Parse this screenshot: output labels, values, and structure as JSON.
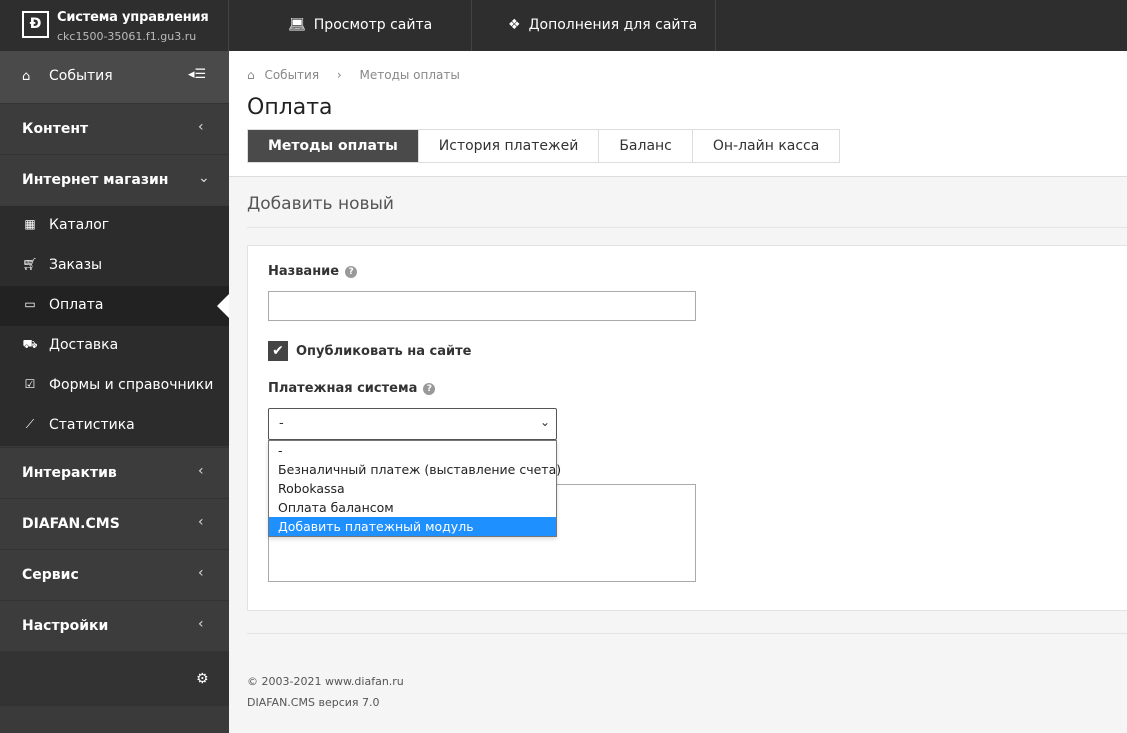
{
  "brand": {
    "logo": "Ɖ",
    "title": "Система управления",
    "subtitle": "ckc1500-35061.f1.gu3.ru"
  },
  "topnav": {
    "view_site": "Просмотр сайта",
    "view_site_icon": "laptop-icon",
    "addons": "Дополнения для сайта",
    "addons_icon": "cubes-icon"
  },
  "sidebar": {
    "events": "События",
    "sections": {
      "content": "Контент",
      "shop": "Интернет магазин",
      "interactive": "Интерактив",
      "diafan": "DIAFAN.CMS",
      "service": "Сервис",
      "settings": "Настройки"
    },
    "shop_items": [
      {
        "label": "Каталог",
        "icon": "grid-icon"
      },
      {
        "label": "Заказы",
        "icon": "cart-icon"
      },
      {
        "label": "Оплата",
        "icon": "credit-card-icon"
      },
      {
        "label": "Доставка",
        "icon": "truck-icon"
      },
      {
        "label": "Формы и справочники",
        "icon": "checkbox-icon"
      },
      {
        "label": "Статистика",
        "icon": "line-chart-icon"
      }
    ]
  },
  "breadcrumb": {
    "home": "События",
    "current": "Методы оплаты"
  },
  "page_title": "Оплата",
  "tabs": [
    "Методы оплаты",
    "История платежей",
    "Баланс",
    "Он-лайн касса"
  ],
  "form": {
    "section_title": "Добавить новый",
    "name_label": "Название",
    "name_value": "",
    "publish_label": "Опубликовать на сайте",
    "publish_checked": true,
    "payment_system_label": "Платежная система",
    "payment_system_value": "-",
    "payment_options": [
      "-",
      "Безналичный платеж (выставление счета)",
      "Robokassa",
      "Оплата балансом",
      "Добавить платежный модуль"
    ],
    "highlighted_option": "Добавить платежный модуль"
  },
  "footer": {
    "copyright": "© 2003-2021 www.diafan.ru",
    "version": "DIAFAN.CMS версия 7.0"
  },
  "colors": {
    "sidebar": "#3a3a3a",
    "topbar": "#2e2e2e",
    "accent": "#1e90ff",
    "active_tab": "#4a4a4a"
  }
}
